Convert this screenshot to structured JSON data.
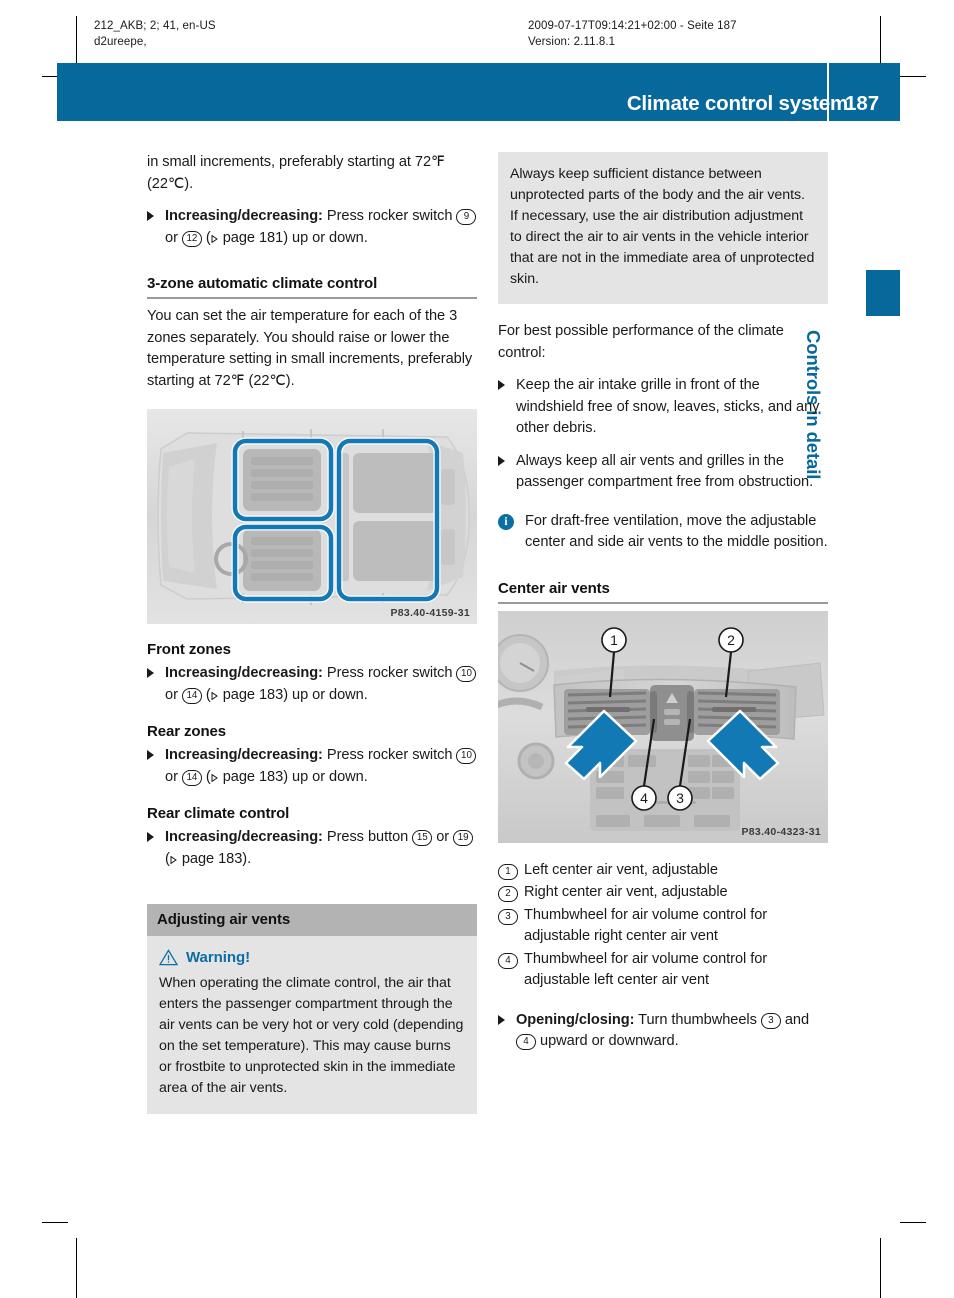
{
  "print_meta": {
    "left": "212_AKB; 2; 41, en-US\nd2ureepe,",
    "right": "2009-07-17T09:14:21+02:00 - Seite 187\nVersion: 2.11.8.1"
  },
  "header": {
    "title": "Climate control system",
    "page_number": "187",
    "accent_color": "#06689b"
  },
  "side_tab": {
    "label": "Controls in detail"
  },
  "left_column": {
    "intro_text": "in small increments, preferably starting at 72℉ (22℃).",
    "intro_step": {
      "bold": "Increasing/decreasing:",
      "text_1": " Press rocker switch ",
      "ref_a": "9",
      "text_2": " or ",
      "ref_b": "12",
      "text_3": " (",
      "page_ref": " page 181) up or down."
    },
    "section_heading": "3-zone automatic climate control",
    "section_text": "You can set the air temperature for each of the 3 zones separately. You should raise or lower the temperature setting in small increments, preferably starting at 72℉ (22℃).",
    "figure_zones_code": "P83.40-4159-31",
    "front_zones": {
      "heading": "Front zones",
      "bold": "Increasing/decreasing:",
      "text_1": " Press rocker switch ",
      "ref_a": "10",
      "text_2": " or ",
      "ref_b": "14",
      "text_3": " (",
      "page_ref": " page 183) up or down."
    },
    "rear_zones": {
      "heading": "Rear zones",
      "bold": "Increasing/decreasing:",
      "text_1": " Press rocker switch ",
      "ref_a": "10",
      "text_2": " or ",
      "ref_b": "14",
      "text_3": " (",
      "page_ref": " page 183) up or down."
    },
    "rear_climate": {
      "heading": "Rear climate control",
      "bold": "Increasing/decreasing:",
      "text_1": " Press button ",
      "ref_a": "15",
      "text_2": " or ",
      "ref_b": "19",
      "text_3": " (",
      "page_ref": " page 183)."
    },
    "band_heading": "Adjusting air vents",
    "warning": {
      "title": "Warning!",
      "body": "When operating the climate control, the air that enters the passenger compartment through the air vents can be very hot or very cold (depending on the set temperature). This may cause burns or frostbite to unprotected skin in the immediate area of the air vents.",
      "color": "#0c6fa3"
    }
  },
  "right_column": {
    "warning_continued": "Always keep sufficient distance between unprotected parts of the body and the air vents. If necessary, use the air distribution adjustment to direct the air to air vents in the vehicle interior that are not in the immediate area of unprotected skin.",
    "best_performance_intro": "For best possible performance of the climate control:",
    "bullets": [
      "Keep the air intake grille in front of the windshield free of snow, leaves, sticks, and any other debris.",
      "Always keep all air vents and grilles in the passenger compartment free from obstruction."
    ],
    "note": "For draft-free ventilation, move the adjustable center and side air vents to the middle position.",
    "section_heading": "Center air vents",
    "figure_vents_code": "P83.40-4323-31",
    "figure_callouts": [
      "1",
      "2",
      "3",
      "4"
    ],
    "legend": [
      {
        "num": "1",
        "text": "Left center air vent, adjustable"
      },
      {
        "num": "2",
        "text": "Right center air vent, adjustable"
      },
      {
        "num": "3",
        "text": "Thumbwheel for air volume control for adjustable right center air vent"
      },
      {
        "num": "4",
        "text": "Thumbwheel for air volume control for adjustable left center air vent"
      }
    ],
    "final_step": {
      "bold": "Opening/closing:",
      "text_1": " Turn thumbwheels ",
      "ref_a": "3",
      "text_2": " and ",
      "ref_b": "4",
      "text_3": " upward or downward."
    }
  }
}
